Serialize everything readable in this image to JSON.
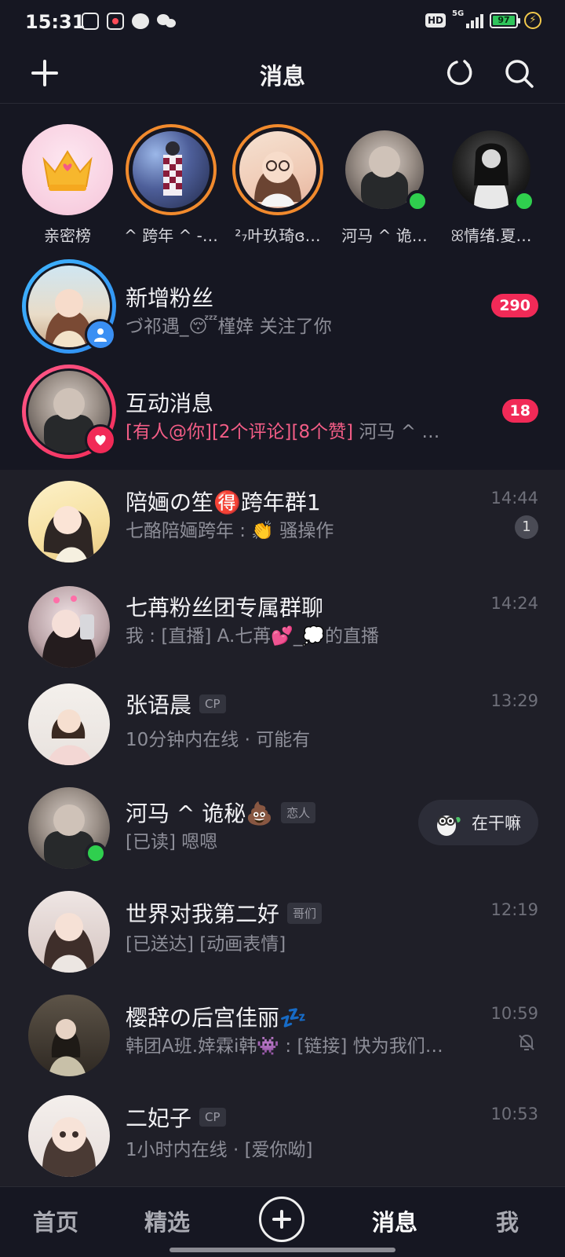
{
  "status_bar": {
    "time": "15:31",
    "hd": "HD",
    "network": "5G",
    "battery": "97"
  },
  "header": {
    "title": "消息",
    "left_icon": "plus-icon",
    "right_icons": [
      "refresh-icon",
      "search-icon"
    ]
  },
  "stories": [
    {
      "label": "亲密榜"
    },
    {
      "label": "^ 跨年 ^ -…"
    },
    {
      "label": "²₇叶玖琦ɞ…"
    },
    {
      "label": "河马 ^ 诡…"
    },
    {
      "label": "ꕤ情绪.夏…"
    }
  ],
  "system": [
    {
      "title": "新增粉丝",
      "subtitle": "づ祁遇_😴槿婞 关注了你",
      "badge": "290"
    },
    {
      "title": "互动消息",
      "subtitle_highlight": "[有人@你][2个评论][8个赞]",
      "subtitle_rest": " 河马 ^ …",
      "badge": "18"
    }
  ],
  "chats": [
    {
      "title": "陪婳の笙🉐跨年群1",
      "subtitle": "七酪陪婳跨年 : 👏 骚操作",
      "time": "14:44",
      "unread": "1"
    },
    {
      "title": "七苒粉丝团专属群聊",
      "subtitle": "我 : [直播] A.七苒💕_💭的直播",
      "time": "14:24"
    },
    {
      "title": "张语晨",
      "tag": "CP",
      "subtitle": "10分钟内在线 · 可能有",
      "time": "13:29"
    },
    {
      "title": "河马 ^ 诡秘💩",
      "tag": "恋人",
      "subtitle": "[已读] 嗯嗯",
      "quick_reply": "在干嘛"
    },
    {
      "title": "世界对我第二好",
      "tag": "哥们",
      "subtitle": "[已送达] [动画表情]",
      "time": "12:19"
    },
    {
      "title": "樱辞の后宫佳丽💤",
      "subtitle": "韩团A班.婞霖i韩👾 : [链接] 快为我们…",
      "time": "10:59"
    },
    {
      "title": "二妃子",
      "tag": "CP",
      "subtitle": "1小时内在线 · [爱你呦]",
      "time": "10:53"
    }
  ],
  "bottom_nav": {
    "home": "首页",
    "featured": "精选",
    "messages": "消息",
    "me": "我"
  },
  "colors": {
    "background": "#161722",
    "accent_pink": "#f12a57",
    "online_green": "#2fcf4e",
    "story_ring_orange": "#f18a2d"
  }
}
